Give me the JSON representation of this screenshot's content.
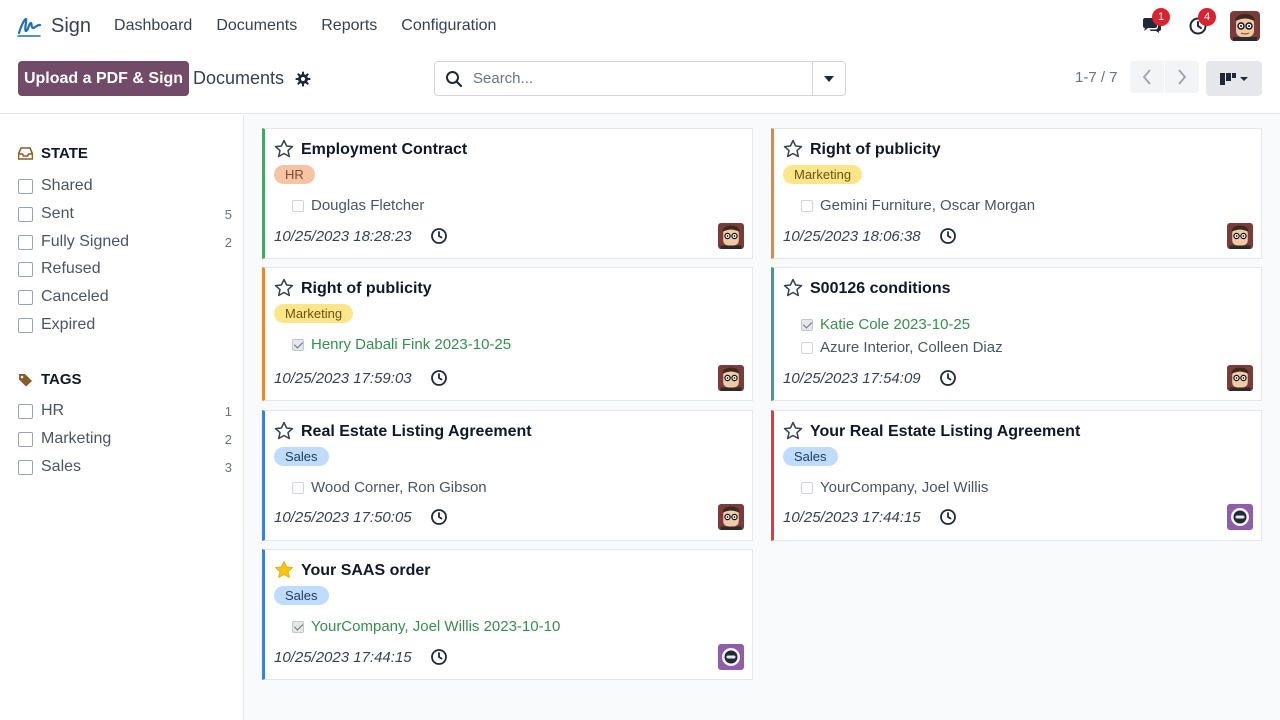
{
  "app": {
    "name": "Sign",
    "menu": [
      "Dashboard",
      "Documents",
      "Reports",
      "Configuration"
    ]
  },
  "systray": {
    "messages_badge": "1",
    "activities_badge": "4"
  },
  "control": {
    "upload_label": "Upload a PDF & Sign",
    "title": "Documents",
    "search_placeholder": "Search...",
    "pager": "1-7 / 7"
  },
  "sidebar": {
    "state_title": "STATE",
    "state_items": [
      {
        "label": "Shared",
        "count": ""
      },
      {
        "label": "Sent",
        "count": "5"
      },
      {
        "label": "Fully Signed",
        "count": "2"
      },
      {
        "label": "Refused",
        "count": ""
      },
      {
        "label": "Canceled",
        "count": ""
      },
      {
        "label": "Expired",
        "count": ""
      }
    ],
    "tags_title": "TAGS",
    "tag_items": [
      {
        "label": "HR",
        "count": "1"
      },
      {
        "label": "Marketing",
        "count": "2"
      },
      {
        "label": "Sales",
        "count": "3"
      }
    ]
  },
  "cards": [
    {
      "title": "Employment Contract",
      "tag": "HR",
      "starred": false,
      "signers": [
        {
          "text": "Douglas Fletcher",
          "signed": false
        }
      ],
      "date": "10/25/2023 18:28:23",
      "avatar": "man",
      "accent": "#49a65c"
    },
    {
      "title": "Right of publicity",
      "tag": "Marketing",
      "starred": false,
      "signers": [
        {
          "text": "Gemini Furniture, Oscar Morgan",
          "signed": false
        }
      ],
      "date": "10/25/2023 18:06:38",
      "avatar": "man",
      "accent": "#e3883c"
    },
    {
      "title": "Right of publicity",
      "tag": "Marketing",
      "starred": false,
      "signers": [
        {
          "text": "Henry Dabali Fink 2023-10-25",
          "signed": true
        }
      ],
      "date": "10/25/2023 17:59:03",
      "avatar": "man",
      "accent": "#e3883c"
    },
    {
      "title": "S00126 conditions",
      "tag": "",
      "starred": false,
      "signers": [
        {
          "text": "Katie Cole 2023-10-25",
          "signed": true
        },
        {
          "text": "Azure Interior, Colleen Diaz",
          "signed": false
        }
      ],
      "date": "10/25/2023 17:54:09",
      "avatar": "man",
      "accent": "#2aa888"
    },
    {
      "title": "Real Estate Listing Agreement",
      "tag": "Sales",
      "starred": false,
      "signers": [
        {
          "text": "Wood Corner, Ron Gibson",
          "signed": false
        }
      ],
      "date": "10/25/2023 17:50:05",
      "avatar": "man",
      "accent": "#3b82d6"
    },
    {
      "title": "Your Real Estate Listing Agreement",
      "tag": "Sales",
      "starred": false,
      "signers": [
        {
          "text": "YourCompany, Joel Willis",
          "signed": false
        }
      ],
      "date": "10/25/2023 17:44:15",
      "avatar": "bot",
      "accent": "#e23b3b"
    },
    {
      "title": "Your SAAS order",
      "tag": "Sales",
      "starred": true,
      "signers": [
        {
          "text": "YourCompany, Joel Willis 2023-10-10",
          "signed": true
        }
      ],
      "date": "10/25/2023 17:44:15",
      "avatar": "bot",
      "accent": "#3b82d6"
    }
  ],
  "colors": {
    "brand": "#714b67",
    "badge": "#d9232e",
    "signed_text": "#3b8c50",
    "star_filled": "#f5c518"
  }
}
